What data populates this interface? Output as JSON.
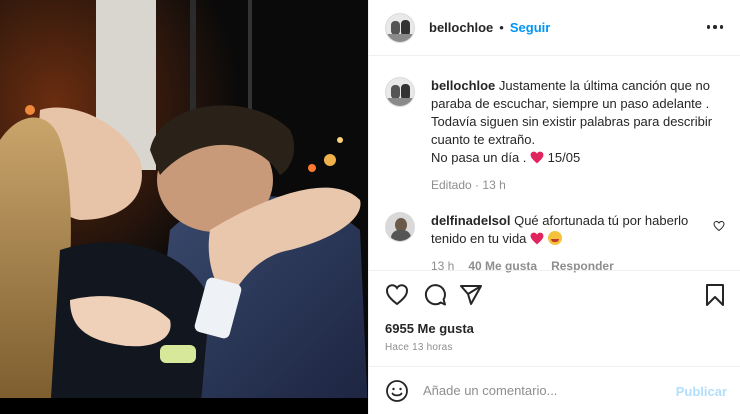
{
  "post": {
    "username": "bellochloe",
    "follow_label": "Seguir",
    "separator": "•"
  },
  "caption": {
    "username": "bellochloe",
    "text_1": "Justamente la última canción que no paraba de escuchar, siempre un paso adelante . Todavía siguen sin existir palabras para describir cuanto te extraño.",
    "text_2": "No pasa un día .",
    "date": "15/05",
    "edited": "Editado",
    "edited_time": "13 h"
  },
  "comment": {
    "username": "delfinadelsol",
    "text": "Qué afortunada tú por haberlo tenido en tu vida",
    "time": "13 h",
    "likes": "40 Me gusta",
    "reply_label": "Responder"
  },
  "stats": {
    "likes": "6955 Me gusta",
    "posted": "Hace 13 horas"
  },
  "add_comment": {
    "placeholder": "Añade un comentario...",
    "publish_label": "Publicar"
  },
  "colors": {
    "accent": "#0095f6",
    "heart": "#ed4956",
    "muted": "#8e8e8e",
    "publish_disabled": "#b2dffc"
  },
  "icons": [
    "more-icon",
    "heart-icon",
    "comment-icon",
    "share-icon",
    "bookmark-icon",
    "emoji-icon"
  ]
}
